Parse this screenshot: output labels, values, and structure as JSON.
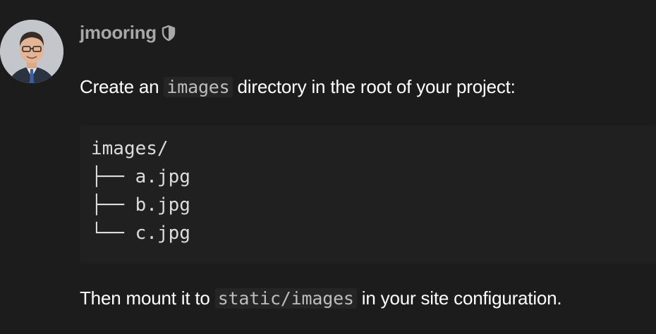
{
  "comment": {
    "author": "jmooring",
    "badge_icon": "shield-icon",
    "paragraph1": {
      "before": "Create an ",
      "code": "images",
      "after": " directory in the root of your project:"
    },
    "code_block": {
      "lines": [
        "images/",
        "├── a.jpg",
        "├── b.jpg",
        "└── c.jpg"
      ]
    },
    "paragraph2": {
      "before": "Then mount it to ",
      "code": "static/images",
      "after": " in your site configuration."
    }
  },
  "colors": {
    "background": "#1c1c1c",
    "code_background": "#202020",
    "username": "#a8a8a8",
    "text": "#ffffff"
  }
}
